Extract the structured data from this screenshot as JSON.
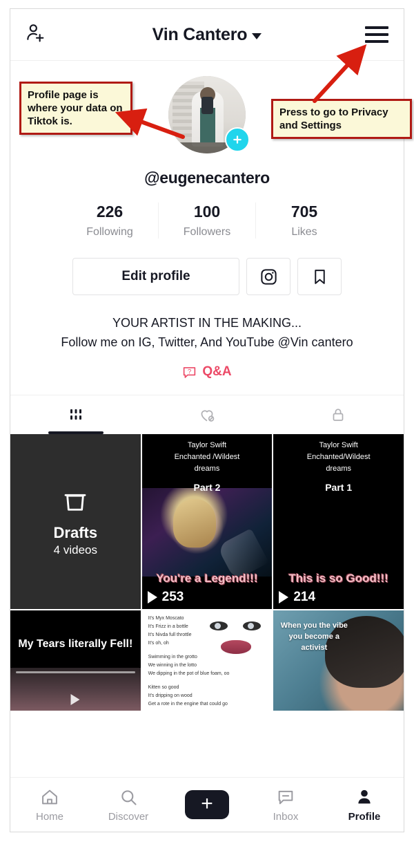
{
  "header": {
    "title": "Vin Cantero",
    "add_friend_icon": "add-person-icon",
    "menu_icon": "hamburger-menu-icon",
    "dropdown_icon": "chevron-down-icon"
  },
  "profile": {
    "username": "@eugenecantero",
    "avatar_alt": "profile-photo",
    "add_badge": "plus-badge",
    "stats": [
      {
        "value": "226",
        "label": "Following"
      },
      {
        "value": "100",
        "label": "Followers"
      },
      {
        "value": "705",
        "label": "Likes"
      }
    ],
    "edit_button": "Edit profile",
    "instagram_icon": "instagram-icon",
    "bookmark_icon": "bookmark-icon",
    "bio_lines": [
      "YOUR ARTIST IN THE MAKING...",
      "Follow me on IG, Twitter, And YouTube @Vin cantero"
    ],
    "qa_label": "Q&A",
    "qa_icon": "question-bubble-icon",
    "qa_color": "#ec4a67"
  },
  "content_tabs": [
    {
      "name": "posts",
      "icon": "grid-icon",
      "active": true
    },
    {
      "name": "liked",
      "icon": "heart-hidden-icon",
      "active": false
    },
    {
      "name": "private",
      "icon": "lock-icon",
      "active": false
    }
  ],
  "grid": {
    "drafts": {
      "icon": "archive-box-icon",
      "title": "Drafts",
      "subtitle": "4 videos"
    },
    "videos": [
      {
        "head_lines": [
          "Taylor Swift",
          "Enchanted /Wildest",
          "dreams"
        ],
        "part": "Part 2",
        "caption": "You're a Legend!!!",
        "views": "253"
      },
      {
        "head_lines": [
          "Taylor Swift",
          "Enchanted/Wildest",
          "dreams"
        ],
        "part": "Part 1",
        "caption": "This is so Good!!!",
        "views": "214"
      },
      {
        "caption": "My Tears literally Fell!"
      },
      {
        "lyric_lines": [
          "It's Myx Moscato",
          "It's Frizz in a bottle",
          "It's Nivda full throttle",
          "It's oh, oh",
          "Swimming in the grotto",
          "We winning in the lotto",
          "We dipping in the pot of blue foam, oo",
          "Kitten so good",
          "It's dripping on wood",
          "Get a rote in the engine that could go"
        ]
      },
      {
        "overlay_lines": [
          "When you the vibe",
          "you become a",
          "activist"
        ]
      }
    ]
  },
  "bottom_nav": [
    {
      "label": "Home",
      "icon": "home-icon",
      "active": false
    },
    {
      "label": "Discover",
      "icon": "search-icon",
      "active": false
    },
    {
      "label": "",
      "icon": "create-plus-icon",
      "active": false
    },
    {
      "label": "Inbox",
      "icon": "inbox-icon",
      "active": false
    },
    {
      "label": "Profile",
      "icon": "person-icon",
      "active": true
    }
  ],
  "annotations": [
    {
      "id": "left",
      "text": "Profile page is where your data on Tiktok is.",
      "border_color": "#b01a14",
      "fill_color": "#fbf8d8"
    },
    {
      "id": "right",
      "text": "Press to go to Privacy and Settings",
      "border_color": "#b01a14",
      "fill_color": "#fbf8d8"
    }
  ]
}
